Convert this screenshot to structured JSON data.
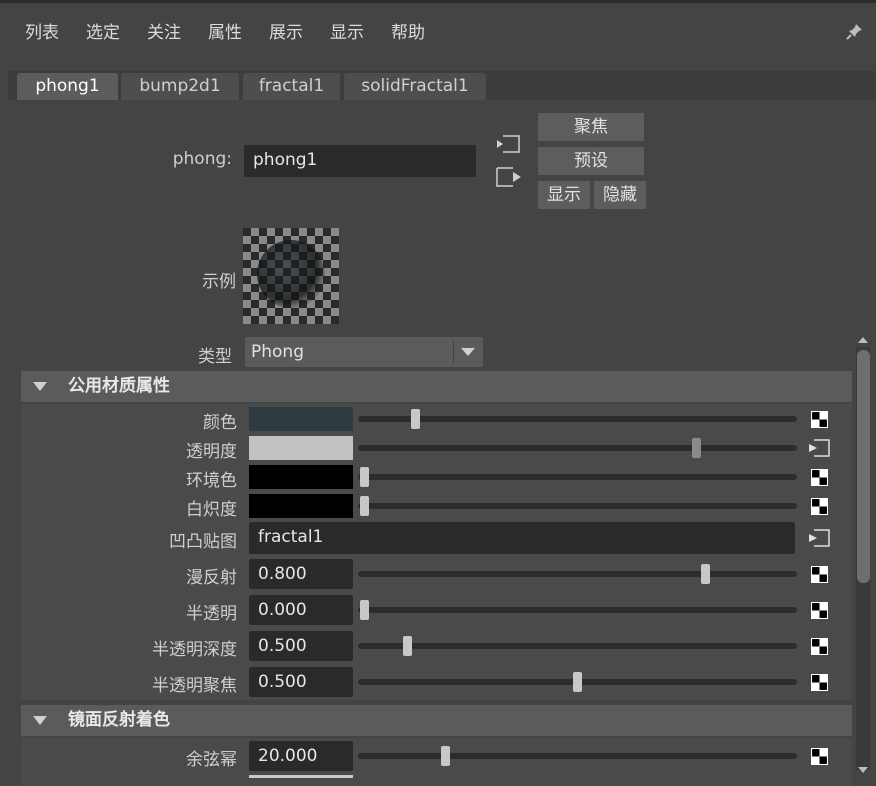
{
  "menu": {
    "items": [
      "列表",
      "选定",
      "关注",
      "属性",
      "展示",
      "显示",
      "帮助"
    ]
  },
  "tabs": [
    "phong1",
    "bump2d1",
    "fractal1",
    "solidFractal1"
  ],
  "header": {
    "node_label": "phong:",
    "node_name": "phong1",
    "focus_btn": "聚焦",
    "preset_btn": "预设",
    "show_btn": "显示",
    "hide_btn": "隐藏",
    "sample_label": "示例",
    "type_label": "类型",
    "type_value": "Phong"
  },
  "common_section": {
    "title": "公用材质属性",
    "rows": [
      {
        "label": "颜色",
        "kind": "color",
        "color": "#2f3b41",
        "slider": 0.12
      },
      {
        "label": "透明度",
        "kind": "color",
        "color": "#c2c2c2",
        "slider": 0.78
      },
      {
        "label": "环境色",
        "kind": "color",
        "color": "#000000",
        "slider": 0.0
      },
      {
        "label": "白炽度",
        "kind": "color",
        "color": "#000000",
        "slider": 0.0
      },
      {
        "label": "凹凸贴图",
        "kind": "map",
        "value": "fractal1"
      },
      {
        "label": "漫反射",
        "kind": "number",
        "value": "0.800",
        "slider": 0.8
      },
      {
        "label": "半透明",
        "kind": "number",
        "value": "0.000",
        "slider": 0.0
      },
      {
        "label": "半透明深度",
        "kind": "number",
        "value": "0.500",
        "slider": 0.1
      },
      {
        "label": "半透明聚焦",
        "kind": "number",
        "value": "0.500",
        "slider": 0.5
      }
    ]
  },
  "specular_section": {
    "title": "镜面反射着色",
    "rows": [
      {
        "label": "余弦幂",
        "kind": "number",
        "value": "20.000",
        "slider": 0.19
      }
    ]
  },
  "colors": {
    "bg": "#444444",
    "field_bg": "#2a2a2a",
    "section_bg": "#5b5b5b",
    "button_bg": "#5d5d5d"
  }
}
